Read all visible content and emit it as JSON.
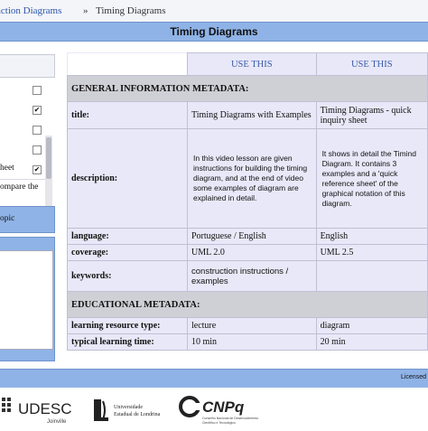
{
  "breadcrumb": {
    "link_text": "action Diagrams",
    "separator": "»",
    "current": "Timing Diagrams"
  },
  "page_title": "Timing Diagrams",
  "sidebar": {
    "items": [
      {
        "checked": false
      },
      {
        "checked": true
      },
      {
        "checked": false
      },
      {
        "checked": false
      },
      {
        "text": "heet",
        "checked": true
      }
    ],
    "compare_text": "ompare the",
    "topic_text": "opic"
  },
  "table": {
    "use_this_label": "USE THIS",
    "general_header": "GENERAL INFORMATION METADATA:",
    "educational_header": "EDUCATIONAL METADATA:",
    "rows": {
      "title": {
        "label": "title:",
        "col1": "Timing Diagrams with Examples",
        "col2": "Timing Diagrams - quick inquiry sheet"
      },
      "description": {
        "label": "description:",
        "col1": "In this video lesson are given instructions for building the timing diagram, and at the end of video some examples of diagram are explained in detail.",
        "col2": "It shows in detail the Timind Diagram. It contains 3 examples and a 'quick reference sheet' of the graphical notation of this diagram."
      },
      "language": {
        "label": "language:",
        "col1": "Portuguese / English",
        "col2": "English"
      },
      "coverage": {
        "label": "coverage:",
        "col1": "UML 2.0",
        "col2": "UML 2.5"
      },
      "keywords": {
        "label": "keywords:",
        "col1": "construction instructions / examples",
        "col2": ""
      },
      "resource_type": {
        "label": "learning resource type:",
        "col1": "lecture",
        "col2": "diagram"
      },
      "learning_time": {
        "label": "typical learning time:",
        "col1": "10 min",
        "col2": "20 min"
      }
    }
  },
  "footer": {
    "text": "Licensed"
  },
  "logos": {
    "udesc": {
      "name": "UDESC",
      "sub": "Joinville"
    },
    "uel": {
      "name": "Universidade Estadual de Londrina"
    },
    "cnpq": {
      "name": "CNPq",
      "sub": "Conselho Nacional de Desenvolvimento Científico e Tecnológico"
    }
  },
  "colors": {
    "accent": "#8fb3e6",
    "table_bg": "#e8e8f8",
    "section_bg": "#cfcfd6",
    "link": "#2b55a8"
  }
}
